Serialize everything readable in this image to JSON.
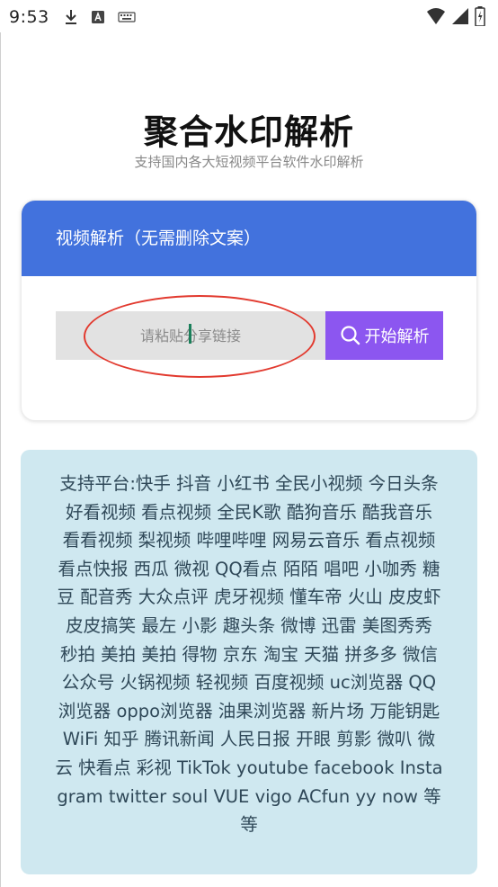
{
  "status_bar": {
    "time": "9:53"
  },
  "header": {
    "title": "聚合水印解析",
    "subtitle": "支持国内各大短视频平台软件水印解析"
  },
  "card": {
    "title": "视频解析（无需删除文案）",
    "input_placeholder": "请粘贴分享链接",
    "input_value": "",
    "button_label": "开始解析"
  },
  "platforms": {
    "text": "支持平台:快手 抖音 小红书 全民小视频 今日头条 好看视频 看点视频 全民K歌 酷狗音乐 酷我音乐 看看视频 梨视频 哔哩哔哩 网易云音乐 看点视频 看点快报 西瓜 微视 QQ看点 陌陌 唱吧 小咖秀 糖豆 配音秀 大众点评 虎牙视频 懂车帝 火山 皮皮虾 皮皮搞笑 最左 小影 趣头条 微博 迅雷 美图秀秀 秒拍 美拍 美拍 得物 京东 淘宝 天猫 拼多多 微信公众号 火锅视频 轻视频 百度视频 uc浏览器 QQ浏览器 oppo浏览器 油果浏览器 新片场 万能钥匙WiFi 知乎 腾讯新闻 人民日报 开眼 剪影 微叭 微云 快看点 彩视 TikTok youtube facebook Instagram twitter soul VUE vigo ACfun yy now 等等"
  },
  "colors": {
    "header_blue": "#4272dd",
    "button_purple": "#8c56f0",
    "annotation_red": "#e23a2f",
    "platform_bg": "#cfe8f0"
  }
}
